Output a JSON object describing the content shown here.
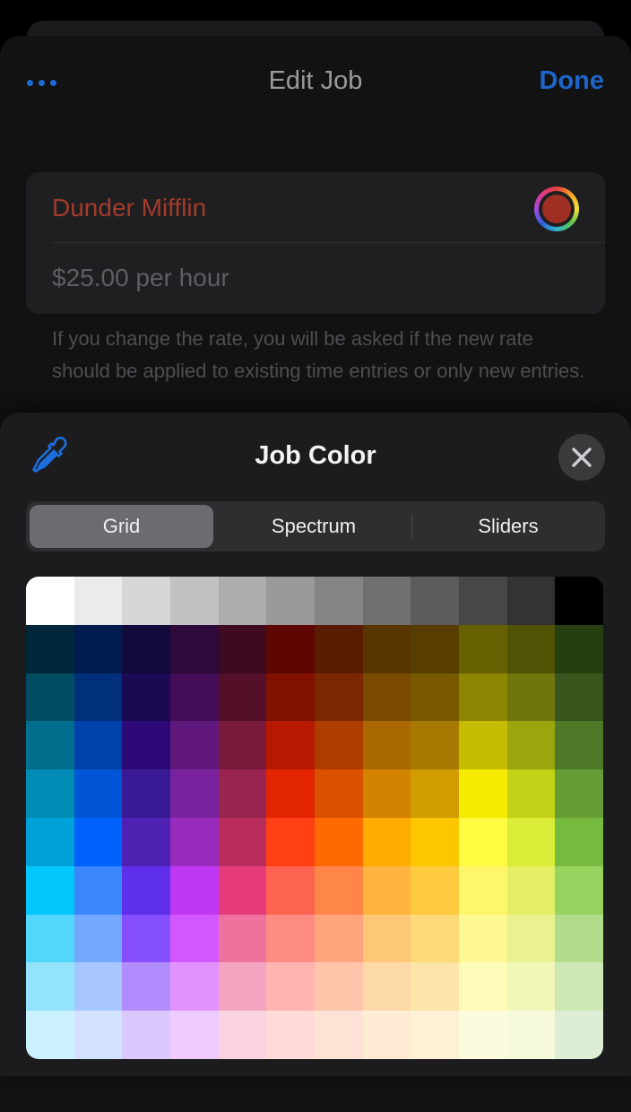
{
  "nav": {
    "title": "Edit Job",
    "done_label": "Done",
    "more_icon": "ellipsis-icon"
  },
  "job": {
    "name": "Dunder Mifflin",
    "name_color": "#a33b2c",
    "rate": "$25.00 per hour",
    "selected_color": "#9e2f22"
  },
  "note": "If you change the rate, you will be asked if the new rate should be applied to existing time entries or only new entries.",
  "color_panel": {
    "title": "Job Color",
    "eyedropper_icon": "eyedropper-icon",
    "close_icon": "close-icon",
    "tabs": [
      {
        "label": "Grid",
        "active": true
      },
      {
        "label": "Spectrum",
        "active": false
      },
      {
        "label": "Sliders",
        "active": false
      }
    ],
    "grid_colors": [
      [
        "#ffffff",
        "#ebebeb",
        "#d6d6d6",
        "#c2c2c2",
        "#adadad",
        "#999999",
        "#858585",
        "#707070",
        "#5c5c5c",
        "#474747",
        "#333333",
        "#000000"
      ],
      [
        "#00263b",
        "#001c4f",
        "#110b3c",
        "#2d0a3b",
        "#3d0a1f",
        "#5d0700",
        "#5a1c00",
        "#593600",
        "#573d00",
        "#666100",
        "#4f5304",
        "#253f11"
      ],
      [
        "#004d64",
        "#002f7b",
        "#1a0a53",
        "#450d59",
        "#541029",
        "#831100",
        "#7b2800",
        "#7a4a00",
        "#785900",
        "#8d8602",
        "#6f760b",
        "#37551c"
      ],
      [
        "#016e8e",
        "#0042ab",
        "#2c0977",
        "#61187c",
        "#791a3d",
        "#b51a00",
        "#ad3e00",
        "#a96800",
        "#a77900",
        "#c4bc00",
        "#9ba50e",
        "#4e7a27"
      ],
      [
        "#008cb4",
        "#0056d6",
        "#371a94",
        "#7a219e",
        "#99244f",
        "#e22400",
        "#da5100",
        "#d38302",
        "#d19d01",
        "#f5eb00",
        "#c3d117",
        "#669d34"
      ],
      [
        "#00a1d8",
        "#0061fd",
        "#4d22b2",
        "#982abc",
        "#b92d5d",
        "#ff4015",
        "#ff6a00",
        "#ffab01",
        "#fdc700",
        "#fefb41",
        "#d9ec37",
        "#76bb40"
      ],
      [
        "#01c7fc",
        "#3a87fd",
        "#5e30eb",
        "#be38f3",
        "#e63b7a",
        "#fe6250",
        "#fe8648",
        "#feb43f",
        "#fecb3e",
        "#fff76b",
        "#e4ef65",
        "#96d35f"
      ],
      [
        "#52d6fc",
        "#74a7ff",
        "#864ffd",
        "#d357fe",
        "#ee719e",
        "#ff8c82",
        "#fea57d",
        "#fec777",
        "#fed977",
        "#fff994",
        "#eaf28f",
        "#b1dd8b"
      ],
      [
        "#93e3fc",
        "#a7c6ff",
        "#b18cfe",
        "#e292fe",
        "#f4a4c0",
        "#ffb5af",
        "#ffc5ab",
        "#fed9a8",
        "#fde4a8",
        "#fffbb9",
        "#f1f7b7",
        "#cde8b5"
      ],
      [
        "#cbf0ff",
        "#d3e2ff",
        "#d9c9fe",
        "#efcaff",
        "#f9d3e0",
        "#ffdbd8",
        "#ffe2d6",
        "#feecd4",
        "#fef1d5",
        "#fdfbdd",
        "#f6fadb",
        "#deeed4"
      ]
    ]
  }
}
